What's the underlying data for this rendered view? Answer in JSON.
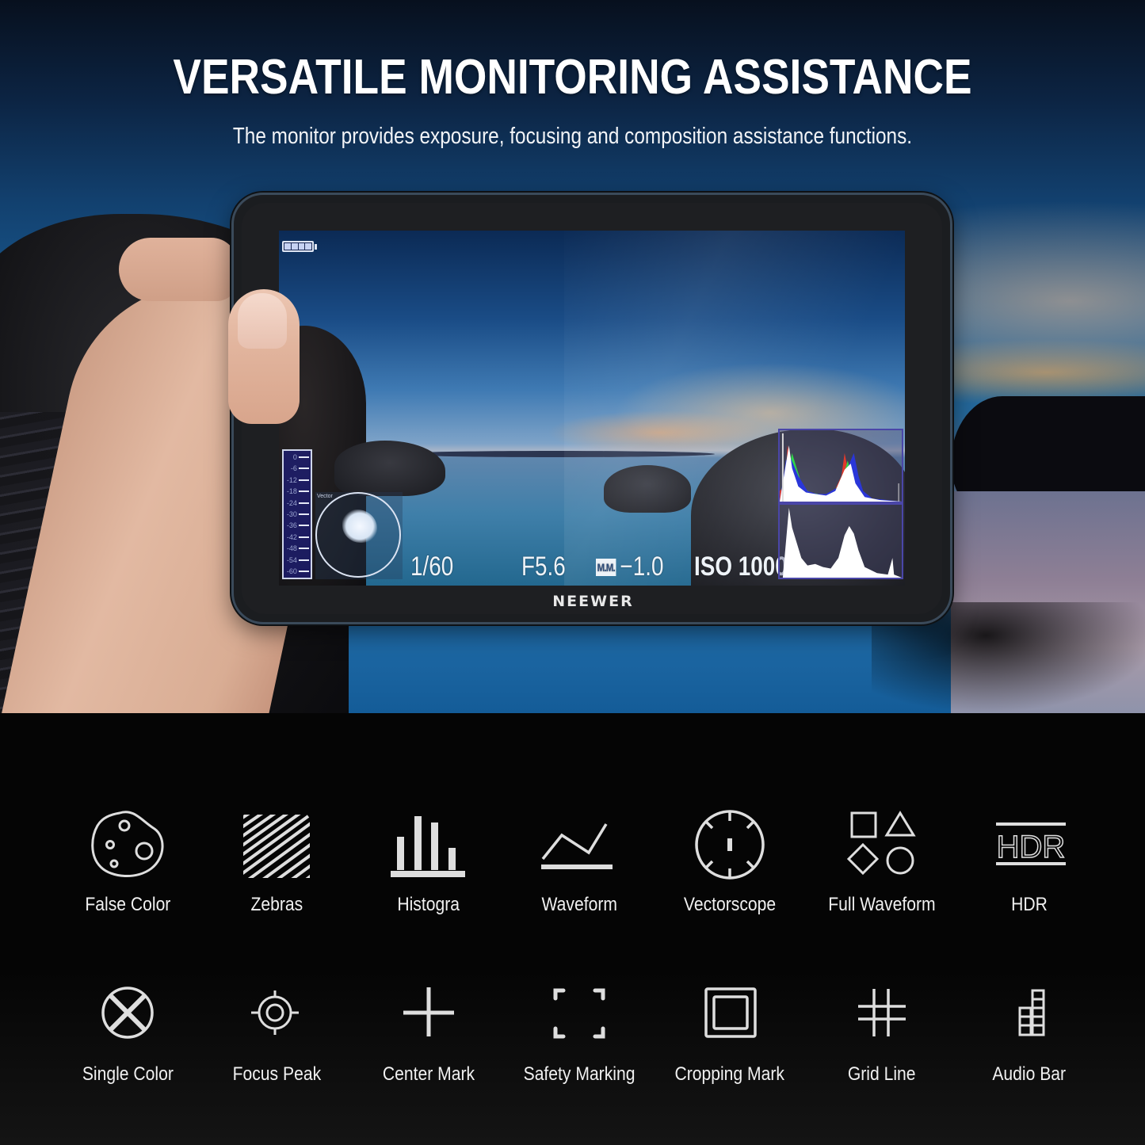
{
  "header": {
    "title": "VERSATILE MONITORING ASSISTANCE",
    "subtitle": "The monitor provides exposure, focusing and composition assistance functions."
  },
  "device": {
    "brand": "NEEWER",
    "screen": {
      "battery_icon": "battery-full-icon",
      "battery_level": 1.0,
      "audio_meter_scale": [
        "0",
        "-6",
        "-12",
        "-18",
        "-24",
        "-30",
        "-36",
        "-42",
        "-48",
        "-54",
        "-60"
      ],
      "vectorscope_label": "Vector",
      "shutter_speed": "1/60",
      "aperture": "F5.6",
      "exposure_mode_badge": "M.M.",
      "exposure_compensation": "−1.0",
      "iso": "ISO 1000",
      "overlays": [
        "rgb-histogram",
        "luma-histogram",
        "vectorscope",
        "audio-meter"
      ]
    }
  },
  "features": {
    "row1": [
      {
        "label": "False Color",
        "icon": "palette-icon"
      },
      {
        "label": "Zebras",
        "icon": "zebra-stripes-icon"
      },
      {
        "label": "Histogra",
        "icon": "histogram-icon"
      },
      {
        "label": "Waveform",
        "icon": "waveform-icon"
      },
      {
        "label": "Vectorscope",
        "icon": "vectorscope-icon"
      },
      {
        "label": "Full Waveform",
        "icon": "shapes-icon"
      },
      {
        "label": "HDR",
        "icon": "hdr-icon"
      }
    ],
    "row2": [
      {
        "label": "Single Color",
        "icon": "circle-x-icon"
      },
      {
        "label": "Focus Peak",
        "icon": "crosshair-target-icon"
      },
      {
        "label": "Center Mark",
        "icon": "plus-icon"
      },
      {
        "label": "Safety Marking",
        "icon": "corner-brackets-icon"
      },
      {
        "label": "Cropping Mark",
        "icon": "nested-squares-icon"
      },
      {
        "label": "Grid Line",
        "icon": "grid-hash-icon"
      },
      {
        "label": "Audio Bar",
        "icon": "audio-level-icon"
      }
    ]
  },
  "colors": {
    "icon_stroke": "#dedede",
    "scope_border": "#4a46a8",
    "hist_red": "#e0392b",
    "hist_green": "#2fd34a",
    "hist_blue": "#2a36d8"
  }
}
